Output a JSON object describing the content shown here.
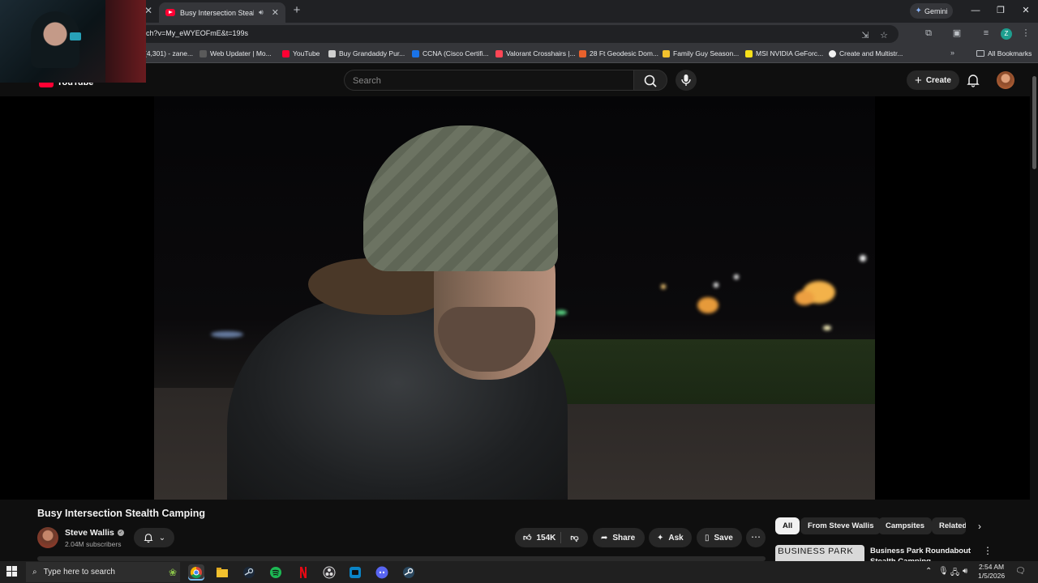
{
  "browser": {
    "tab_title": "Busy Intersection Stealth Camping",
    "tab_audio_icon": "speaker-icon",
    "new_tab_label": "+",
    "gemini_label": "Gemini",
    "url": "ch?v=My_eWYEOFmE&t=199s",
    "profile_initial": "Z",
    "bookmarks": [
      {
        "label": "(4,301) - zane...",
        "color": "#3a3a3a"
      },
      {
        "label": "Web Updater | Mo...",
        "color": "#5a5a5a"
      },
      {
        "label": "YouTube",
        "color": "#ff0033"
      },
      {
        "label": "Buy Grandaddy Pur...",
        "color": "#cfcfcf"
      },
      {
        "label": "CCNA (Cisco Certifi...",
        "color": "#1a73e8"
      },
      {
        "label": "Valorant Crosshairs |...",
        "color": "#ff4655"
      },
      {
        "label": "28 Ft Geodesic Dom...",
        "color": "#e8612c"
      },
      {
        "label": "Family Guy Season...",
        "color": "#f2c12e"
      },
      {
        "label": "MSI NVIDIA GeForc...",
        "color": "#f6e01a"
      },
      {
        "label": "Create and Multistr...",
        "color": "#f1f1f1"
      }
    ],
    "all_bookmarks_label": "All Bookmarks"
  },
  "youtube": {
    "logo_text": "YouTube",
    "search_placeholder": "Search",
    "create_label": "Create"
  },
  "video": {
    "title": "Busy Intersection Stealth Camping",
    "channel_name": "Steve Wallis",
    "subscribers": "2.04M subscribers",
    "like_count": "154K",
    "share_label": "Share",
    "ask_label": "Ask",
    "save_label": "Save"
  },
  "chips": [
    {
      "label": "All",
      "active": true
    },
    {
      "label": "From Steve Wallis",
      "active": false
    },
    {
      "label": "Campsites",
      "active": false
    },
    {
      "label": "Related",
      "active": false
    }
  ],
  "recommendation": {
    "thumb_text": "BUSINESS PARK",
    "title": "Business Park Roundabout Stealth Camping"
  },
  "taskbar": {
    "search_placeholder": "Type here to search",
    "time": "2:54 AM",
    "date": "1/5/2026",
    "apps": [
      {
        "name": "chrome-app",
        "color": "#4285f4"
      },
      {
        "name": "file-explorer-app",
        "color": "#f2c12e"
      },
      {
        "name": "steam-app",
        "color": "#1b2838"
      },
      {
        "name": "spotify-app",
        "color": "#1db954"
      },
      {
        "name": "netflix-app",
        "color": "#e50914"
      },
      {
        "name": "obs-app",
        "color": "#3a3a3a"
      },
      {
        "name": "streamlabs-app",
        "color": "#0a84c7"
      },
      {
        "name": "discord-app",
        "color": "#5865f2"
      },
      {
        "name": "steam-app-2",
        "color": "#2a475e"
      }
    ]
  }
}
